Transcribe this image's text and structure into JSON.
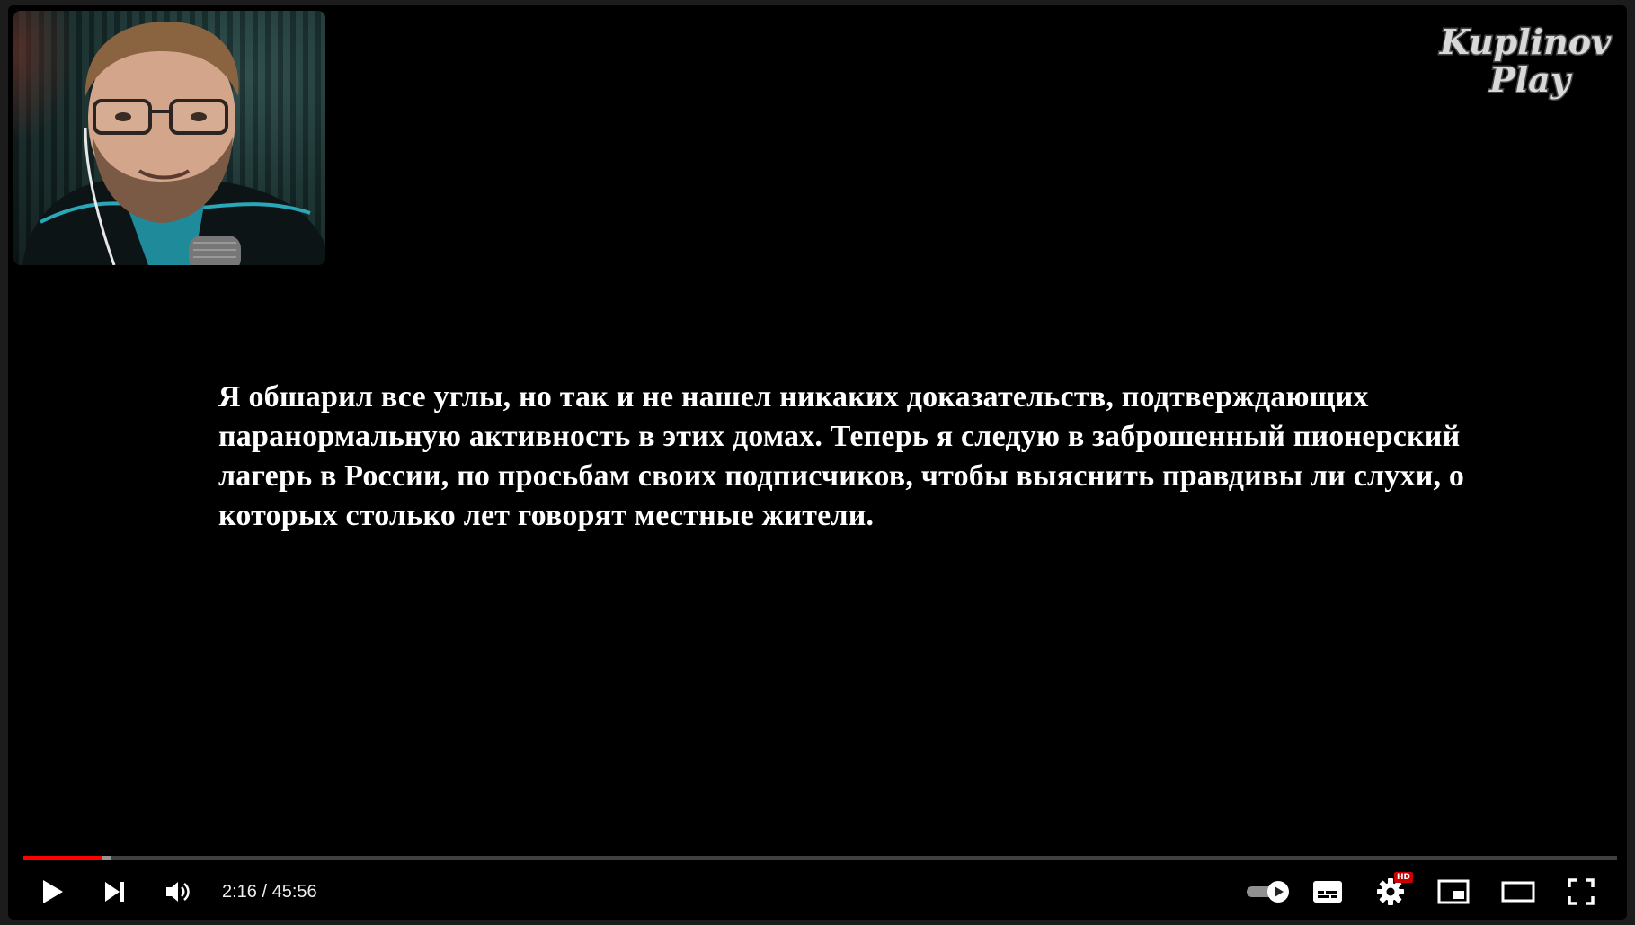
{
  "video": {
    "subtitle_text": "Я обшарил все углы, но так и не нашел никаких доказательств, подтверждающих паранормальную активность в этих домах. Теперь я следую в заброшенный пионерский лагерь в России, по просьбам своих подписчиков, чтобы выяснить правдивы ли слухи, о которых столько лет говорят местные жители.",
    "watermark_logo": "Kuplinov Play"
  },
  "progress": {
    "played_fraction": 0.0497,
    "loaded_fraction": 0.0545,
    "played_color": "#ff0000"
  },
  "controls": {
    "current_time": "2:16",
    "separator": " / ",
    "duration": "45:56",
    "settings_badge": "HD",
    "icons": [
      "play-icon",
      "next-icon",
      "volume-icon",
      "autoplay-toggle-icon",
      "subtitles-icon",
      "settings-icon",
      "miniplayer-icon",
      "theater-mode-icon",
      "fullscreen-icon"
    ]
  }
}
